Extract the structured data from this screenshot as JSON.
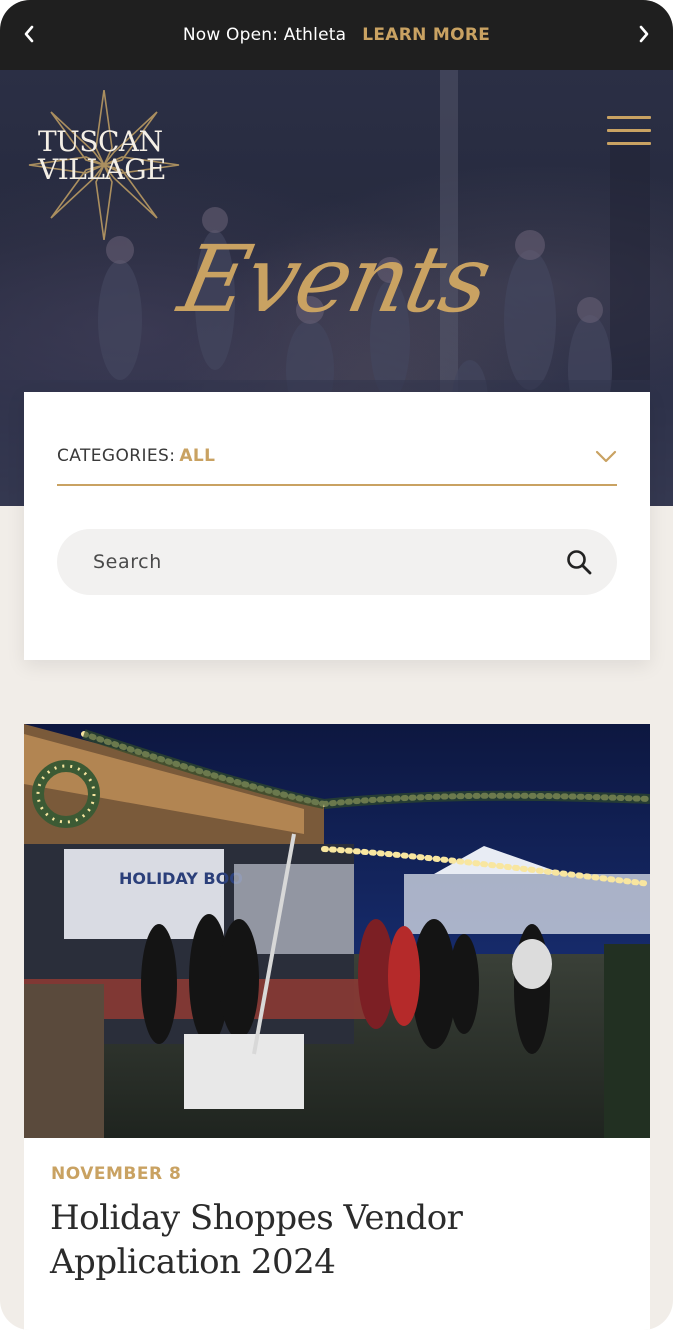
{
  "announcement": {
    "message": "Now Open: Athleta",
    "cta": "LEARN MORE"
  },
  "brand": {
    "logo_text_line1": "TUSCAN",
    "logo_text_line2": "VILLAGE"
  },
  "hero": {
    "title": "Events"
  },
  "filters": {
    "categories_label": "CATEGORIES:",
    "categories_value": "ALL",
    "search_placeholder": "Search"
  },
  "events": [
    {
      "date": "NOVEMBER 8",
      "title": "Holiday Shoppes Vendor Application 2024",
      "image_sign": "HOLIDAY BOO"
    }
  ],
  "colors": {
    "accent": "#c9a262",
    "bar": "#1f1f1f",
    "page_bg": "#f1ede8"
  }
}
